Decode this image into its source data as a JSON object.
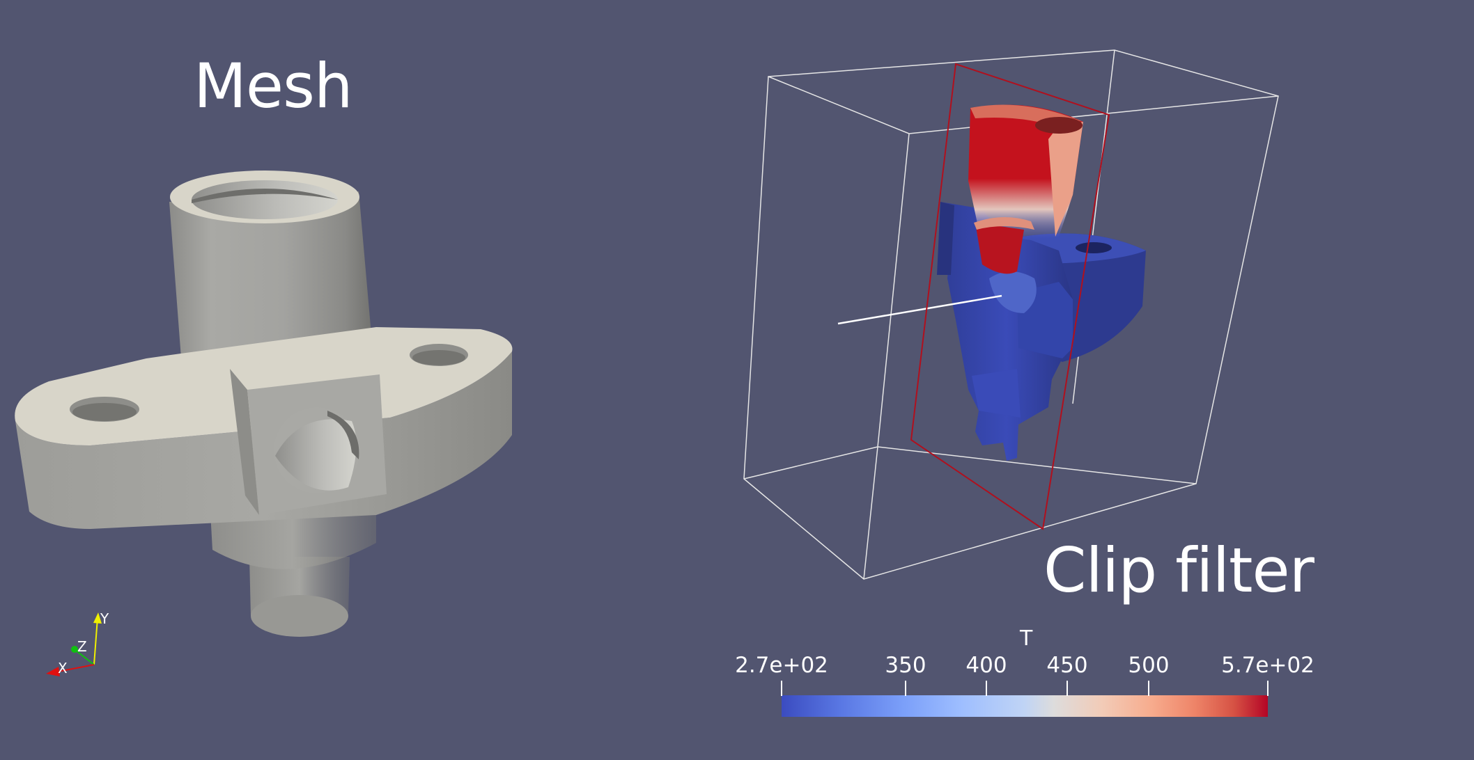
{
  "titles": {
    "left": "Mesh",
    "right": "Clip filter"
  },
  "colorbar": {
    "title": "T",
    "ticks": [
      "2.7e+02",
      "350",
      "400",
      "450",
      "500",
      "5.7e+02"
    ],
    "colormap": "cool-to-warm"
  },
  "orientation_axes": {
    "x_label": "X",
    "y_label": "Y",
    "z_label": "Z",
    "x_color": "#e01010",
    "y_color": "#f0f000",
    "z_color": "#10c010"
  },
  "colors": {
    "background": "#525570",
    "mesh_surface": "#c8c6bd",
    "clip_plane_outline": "#b0101e",
    "bounding_box": "#e6e6e6"
  }
}
